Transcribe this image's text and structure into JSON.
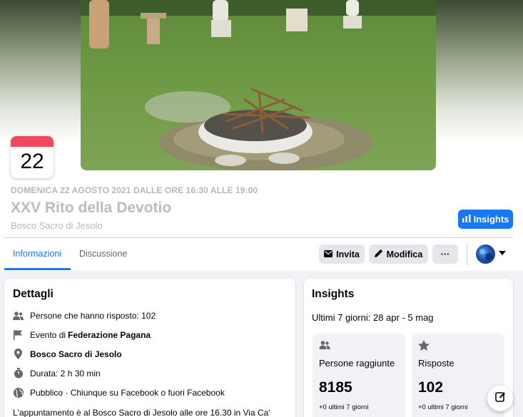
{
  "event": {
    "day": "22",
    "when": "DOMENICA 22 AGOSTO 2021 DALLE ORE 16:30 ALLE 19:00",
    "title": "XXV Rito della Devotio",
    "place": "Bosco Sacro di Jesolo"
  },
  "header_buttons": {
    "insights": "Insights"
  },
  "tabs": [
    {
      "label": "Informazioni",
      "active": true
    },
    {
      "label": "Discussione",
      "active": false
    }
  ],
  "actions": {
    "invite": "Invita",
    "edit": "Modifica",
    "more": "···"
  },
  "details": {
    "title": "Dettagli",
    "responded_label": "Persone che hanno risposto: 102",
    "event_by_prefix": "Evento di",
    "event_by_name": "Federazione Pagana",
    "location": "Bosco Sacro di Jesolo",
    "duration": "Durata: 2 h 30 min",
    "privacy": "Pubblico · Chiunque su Facebook o fuori Facebook",
    "description": "L'appuntamento è al Bosco Sacro di Jesolo alle ore 16.30 in Via Ca'"
  },
  "insights": {
    "title": "Insights",
    "period_label": "Ultimi 7 giorni:",
    "period_value": "28 apr - 5 mag",
    "stats": [
      {
        "label": "Persone raggiunte",
        "value": "8185",
        "sub": "+0 ultimi 7 giorni",
        "icon": "people-icon"
      },
      {
        "label": "Risposte",
        "value": "102",
        "sub": "+0 ultimi 7 giorni",
        "icon": "star-icon"
      }
    ]
  },
  "colors": {
    "accent": "#1877f2",
    "calendar_red": "#f0485e",
    "background": "#f0f2f5"
  }
}
